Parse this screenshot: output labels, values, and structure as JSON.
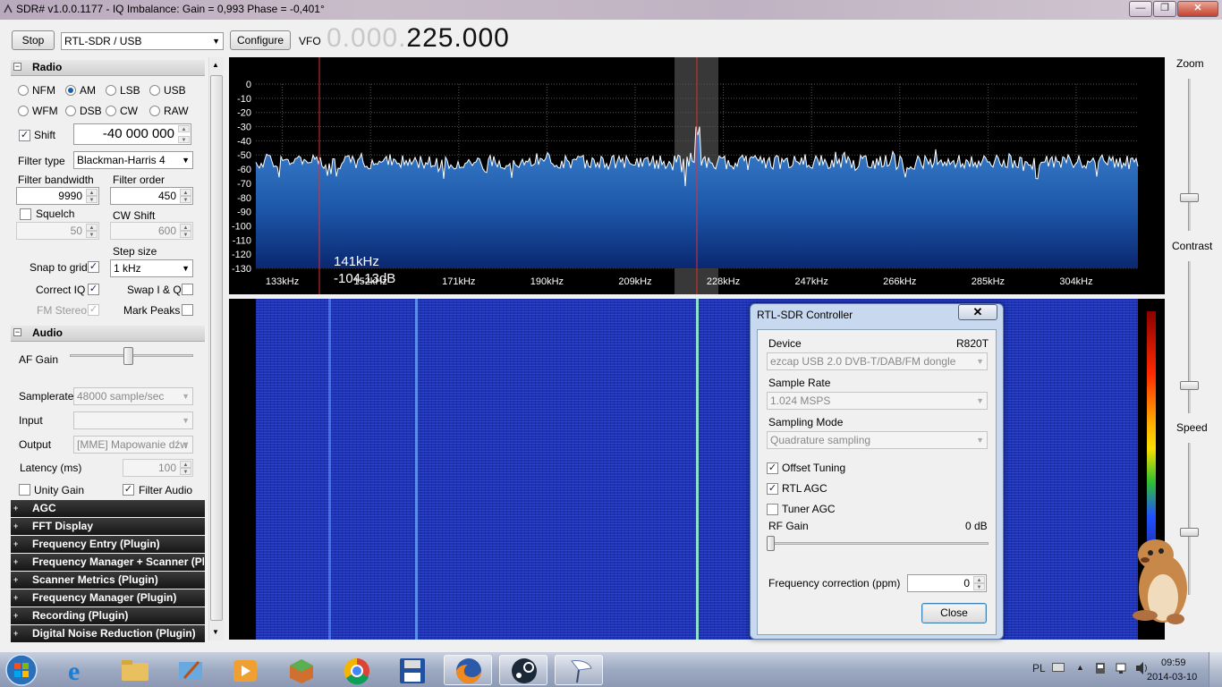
{
  "window": {
    "title": "SDR# v1.0.0.1177 - IQ Imbalance: Gain = 0,993 Phase = -0,401°",
    "minimize": "—",
    "restore": "❐",
    "close": "✕"
  },
  "toolbar": {
    "stop_label": "Stop",
    "source": "RTL-SDR / USB",
    "configure_label": "Configure",
    "vfo_label": "VFO",
    "vfo_dim": "0.000.",
    "vfo_value": "225.000"
  },
  "radio": {
    "section": "Radio",
    "modes": [
      {
        "label": "NFM",
        "selected": false
      },
      {
        "label": "AM",
        "selected": true
      },
      {
        "label": "LSB",
        "selected": false
      },
      {
        "label": "USB",
        "selected": false
      },
      {
        "label": "WFM",
        "selected": false
      },
      {
        "label": "DSB",
        "selected": false
      },
      {
        "label": "CW",
        "selected": false
      },
      {
        "label": "RAW",
        "selected": false
      }
    ],
    "shift_label": "Shift",
    "shift_value": "-40 000 000",
    "filter_type_label": "Filter type",
    "filter_type": "Blackman-Harris 4",
    "filter_bandwidth_label": "Filter bandwidth",
    "filter_bandwidth": "9990",
    "filter_order_label": "Filter order",
    "filter_order": "450",
    "squelch_label": "Squelch",
    "squelch_value": "50",
    "cw_shift_label": "CW Shift",
    "cw_shift_value": "600",
    "step_size_label": "Step size",
    "step_size": "1 kHz",
    "snap_label": "Snap to grid",
    "swap_label": "Swap I & Q",
    "correct_iq_label": "Correct IQ",
    "fm_stereo_label": "FM Stereo",
    "mark_peaks_label": "Mark Peaks"
  },
  "audio": {
    "section": "Audio",
    "af_gain_label": "AF Gain",
    "af_gain": 0.47,
    "samplerate_label": "Samplerate",
    "samplerate": "48000 sample/sec",
    "input_label": "Input",
    "input": "",
    "output_label": "Output",
    "output": "[MME] Mapowanie dźw",
    "latency_label": "Latency (ms)",
    "latency": "100",
    "unity_gain_label": "Unity Gain",
    "filter_audio_label": "Filter Audio"
  },
  "sections": [
    "AGC",
    "FFT Display",
    "Frequency Entry (Plugin)",
    "Frequency Manager + Scanner (Plugin)",
    "Scanner Metrics (Plugin)",
    "Frequency Manager (Plugin)",
    "Recording (Plugin)",
    "Digital Noise Reduction (Plugin)"
  ],
  "spectrum": {
    "db_ticks": [
      "0",
      "-10",
      "-20",
      "-30",
      "-40",
      "-50",
      "-60",
      "-70",
      "-80",
      "-90",
      "-100",
      "-110",
      "-120",
      "-130"
    ],
    "freq_ticks": [
      "133kHz",
      "152kHz",
      "171kHz",
      "190kHz",
      "209kHz",
      "228kHz",
      "247kHz",
      "266kHz",
      "285kHz",
      "304kHz"
    ],
    "cursor_freq": "141kHz",
    "cursor_db": "-104.13dB"
  },
  "right_panel": {
    "zoom_label": "Zoom",
    "contrast_label": "Contrast",
    "speed_label": "Speed"
  },
  "dialog": {
    "title": "RTL-SDR Controller",
    "close_x": "✕",
    "device_label": "Device",
    "device_tuner": "R820T",
    "device": "ezcap USB 2.0 DVB-T/DAB/FM dongle",
    "sample_rate_label": "Sample Rate",
    "sample_rate": "1.024 MSPS",
    "sampling_mode_label": "Sampling Mode",
    "sampling_mode": "Quadrature sampling",
    "offset_tuning_label": "Offset Tuning",
    "rtl_agc_label": "RTL AGC",
    "tuner_agc_label": "Tuner AGC",
    "rf_gain_label": "RF Gain",
    "rf_gain_value": "0 dB",
    "freq_corr_label": "Frequency correction (ppm)",
    "freq_corr": "0",
    "close_label": "Close"
  },
  "taskbar": {
    "lang": "PL",
    "time": "09:59",
    "date": "2014-03-10"
  },
  "colors": {
    "spectrum_fill": "#1f63b0",
    "waterfall": "#1d2fb8",
    "accent_red": "#e03030"
  }
}
